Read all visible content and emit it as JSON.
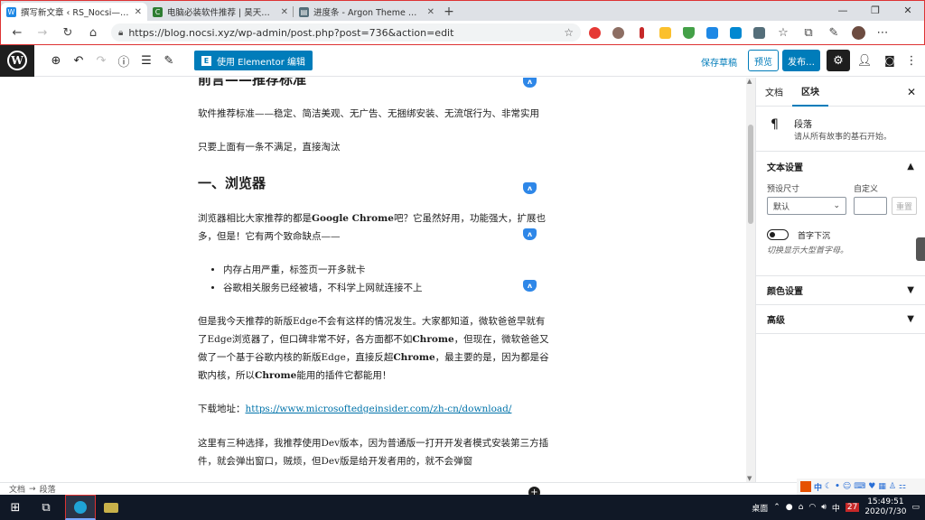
{
  "browser": {
    "tabs": [
      {
        "label": "撰写新文章 ‹ RS_Nocsi—博客论坛",
        "active": true,
        "favicon_color": "#1e88e5"
      },
      {
        "label": "电脑必装软件推荐 | 昊天博客",
        "active": false,
        "favicon_color": "#2e7d32"
      },
      {
        "label": "进度条 - Argon Theme Docs",
        "active": false,
        "favicon_color": "#546e7a"
      }
    ],
    "new_tab": "+",
    "url": "https://blog.nocsi.xyz/wp-admin/post.php?post=736&action=edit",
    "window_controls": [
      "—",
      "❐",
      "✕"
    ]
  },
  "wp": {
    "elementor_label": "使用 Elementor 编辑",
    "save_draft": "保存草稿",
    "preview": "预览",
    "publish": "发布…"
  },
  "content": {
    "heading_partial": "前言——推荐标准",
    "p1": "软件推荐标准——稳定、简洁美观、无广告、无捆绑安装、无流氓行为、非常实用",
    "p2": "只要上面有一条不满足，直接淘汰",
    "h_browser": "一、浏览器",
    "p3_a": "浏览器相比大家推荐的都是",
    "p3_b": "Google Chrome",
    "p3_c": "吧？它虽然好用，功能强大，扩展也多，但是！它有两个致命缺点——",
    "bullets": [
      "内存占用严重，标签页一开多就卡",
      "谷歌相关服务已经被墙，不科学上网就连接不上"
    ],
    "p4_a": "但是我今天推荐的新版Edge不会有这样的情况发生。大家都知道，微软爸爸早就有了Edge浏览器了，但口碑非常不好，各方面都不如",
    "p4_b": "Chrome",
    "p4_c": "，但现在，微软爸爸又做了一个基于谷歌内核的新版Edge，直接反超",
    "p4_d": "Chrome",
    "p4_e": "，最主要的是，因为都是谷歌内核，所以",
    "p4_f": "Chrome",
    "p4_g": "能用的插件它都能用！",
    "download_label": "下载地址：",
    "download_url": "https://www.microsoftedgeinsider.com/zh-cn/download/",
    "p5": "这里有三种选择，我推荐使用Dev版本，因为普通版一打开开发者模式安装第三方插件，就会弹出窗口，贼烦，但Dev版是给开发者用的，就不会弹窗"
  },
  "footer": {
    "crumb1": "文档",
    "arrow": "→",
    "crumb2": "段落"
  },
  "sidebar": {
    "tab_doc": "文档",
    "tab_block": "区块",
    "block_name": "段落",
    "block_desc": "请从所有故事的基石开始。",
    "text_settings": "文本设置",
    "preset_label": "预设尺寸",
    "custom_label": "自定义",
    "preset_value": "默认",
    "reset": "重置",
    "dropcap_label": "首字下沉",
    "dropcap_help": "切换显示大型首字母。",
    "color_settings": "颜色设置",
    "advanced": "高级"
  },
  "tray": {
    "ime": "中",
    "desktop": "桌面",
    "ime_mode": "中",
    "time": "15:49:51",
    "date": "2020/7/30",
    "badge": "27"
  }
}
